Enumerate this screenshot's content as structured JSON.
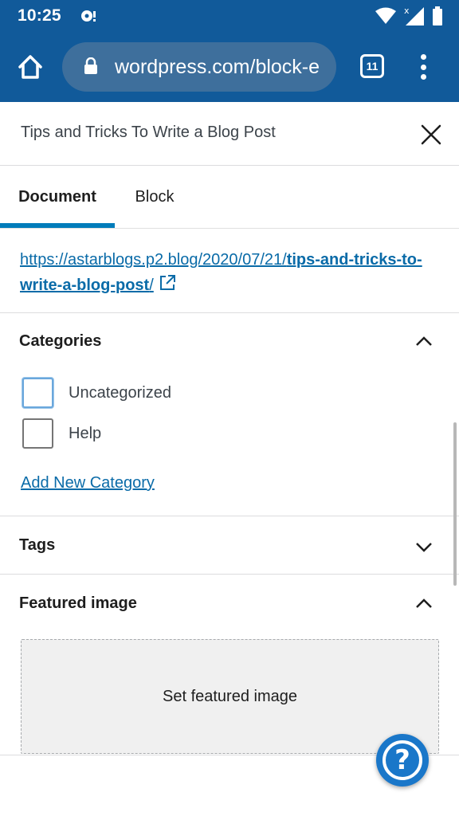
{
  "status_bar": {
    "time": "10:25",
    "icons": [
      "notification-icon",
      "wifi-icon",
      "signal-icon",
      "battery-icon"
    ]
  },
  "browser": {
    "url": "wordpress.com/block-e",
    "tab_count": "11",
    "icons": [
      "home-icon",
      "lock-icon",
      "overflow-menu-icon"
    ]
  },
  "sidebar": {
    "post_title": "Tips and Tricks To Write a Blog Post",
    "tabs": [
      {
        "label": "Document",
        "active": true
      },
      {
        "label": "Block",
        "active": false
      }
    ],
    "permalink": {
      "prefix": "https://astarblogs.p2.blog/2020/07/21/",
      "slug": "tips-and-tricks-to-write-a-blog-post",
      "suffix": "/"
    },
    "categories": {
      "title": "Categories",
      "items": [
        {
          "label": "Uncategorized",
          "checked": false
        },
        {
          "label": "Help",
          "checked": false
        }
      ],
      "add_link": "Add New Category"
    },
    "tags": {
      "title": "Tags"
    },
    "featured_image": {
      "title": "Featured image",
      "button_label": "Set featured image"
    }
  },
  "colors": {
    "browser_bar": "#115a9a",
    "accent": "#007cba",
    "link": "#0a6ba8",
    "help_button": "#1a77c9"
  }
}
